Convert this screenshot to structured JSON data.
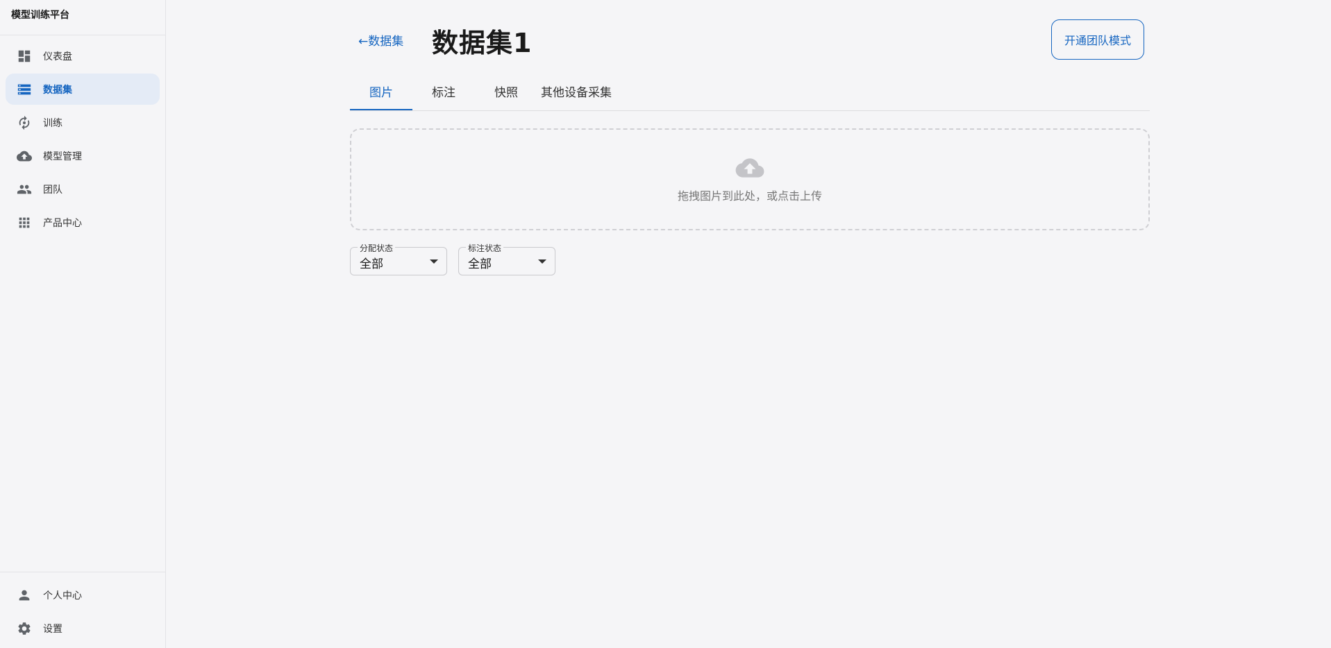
{
  "app": {
    "title": "模型训练平台"
  },
  "sidebar": {
    "items": [
      {
        "label": "仪表盘",
        "icon": "dashboard-icon"
      },
      {
        "label": "数据集",
        "icon": "dataset-icon",
        "active": true
      },
      {
        "label": "训练",
        "icon": "training-icon"
      },
      {
        "label": "模型管理",
        "icon": "cloud-upload-icon"
      },
      {
        "label": "团队",
        "icon": "team-icon"
      },
      {
        "label": "产品中心",
        "icon": "grid-icon"
      }
    ],
    "bottom_items": [
      {
        "label": "个人中心",
        "icon": "person-icon"
      },
      {
        "label": "设置",
        "icon": "gear-icon"
      }
    ]
  },
  "header": {
    "back_label": "←数据集",
    "title": "数据集1",
    "team_button": "开通团队模式"
  },
  "tabs": [
    {
      "label": "图片",
      "active": true
    },
    {
      "label": "标注"
    },
    {
      "label": "快照"
    },
    {
      "label": "其他设备采集"
    }
  ],
  "upload": {
    "hint": "拖拽图片到此处，或点击上传"
  },
  "filters": [
    {
      "label": "分配状态",
      "value": "全部"
    },
    {
      "label": "标注状态",
      "value": "全部"
    }
  ],
  "colors": {
    "accent": "#1565c0",
    "active_bg": "#e4ebf6",
    "icon_gray": "#5f6368"
  }
}
